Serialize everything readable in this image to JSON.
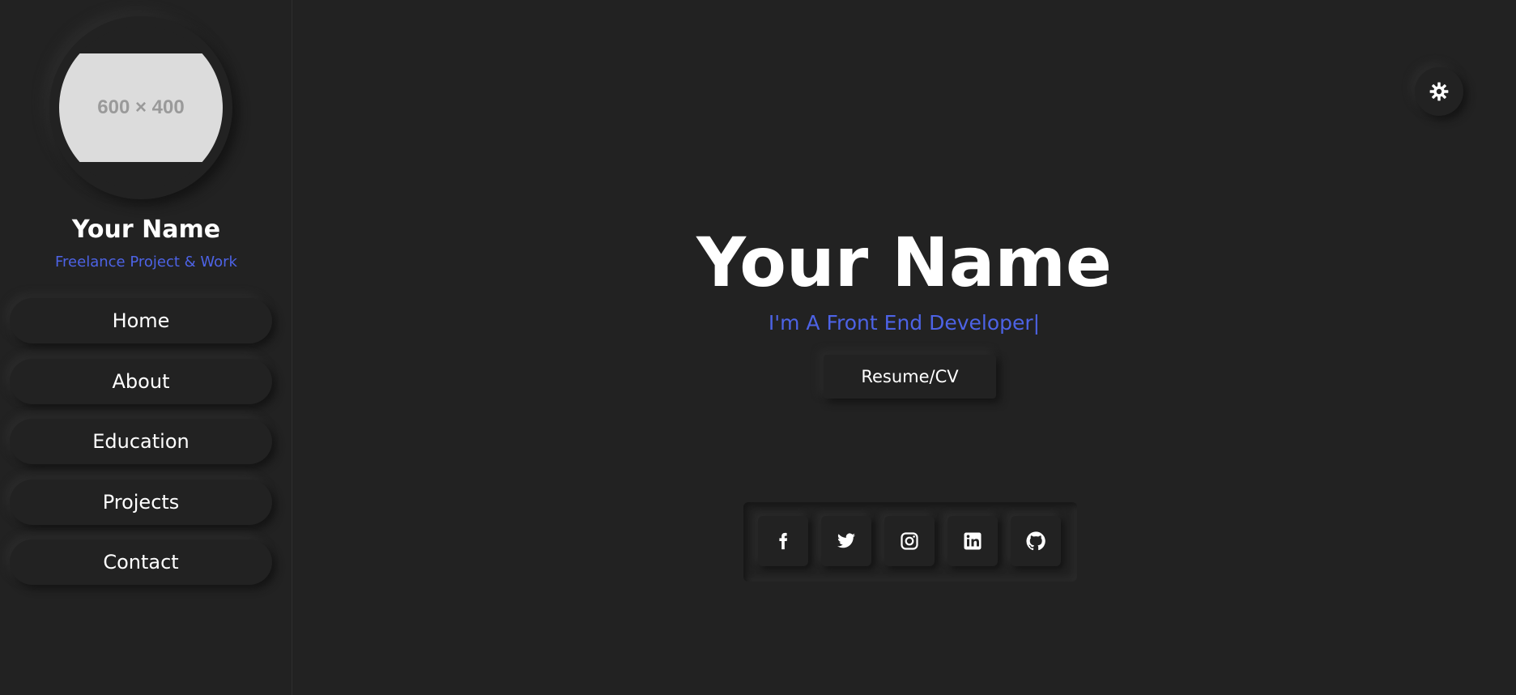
{
  "sidebar": {
    "avatar_placeholder": "600 × 400",
    "name": "Your Name",
    "role": "Freelance Project & Work",
    "nav": [
      {
        "label": "Home"
      },
      {
        "label": "About"
      },
      {
        "label": "Education"
      },
      {
        "label": "Projects"
      },
      {
        "label": "Contact"
      }
    ]
  },
  "header": {
    "theme_toggle_icon": "gear-icon"
  },
  "hero": {
    "name": "Your Name",
    "typed_role": "I'm A Front End Developer|",
    "resume_label": "Resume/CV"
  },
  "social": [
    {
      "icon": "facebook-icon"
    },
    {
      "icon": "twitter-icon"
    },
    {
      "icon": "instagram-icon"
    },
    {
      "icon": "linkedin-icon"
    },
    {
      "icon": "github-icon"
    }
  ],
  "colors": {
    "background": "#222222",
    "accent": "#4d63e6",
    "text": "#ffffff"
  }
}
